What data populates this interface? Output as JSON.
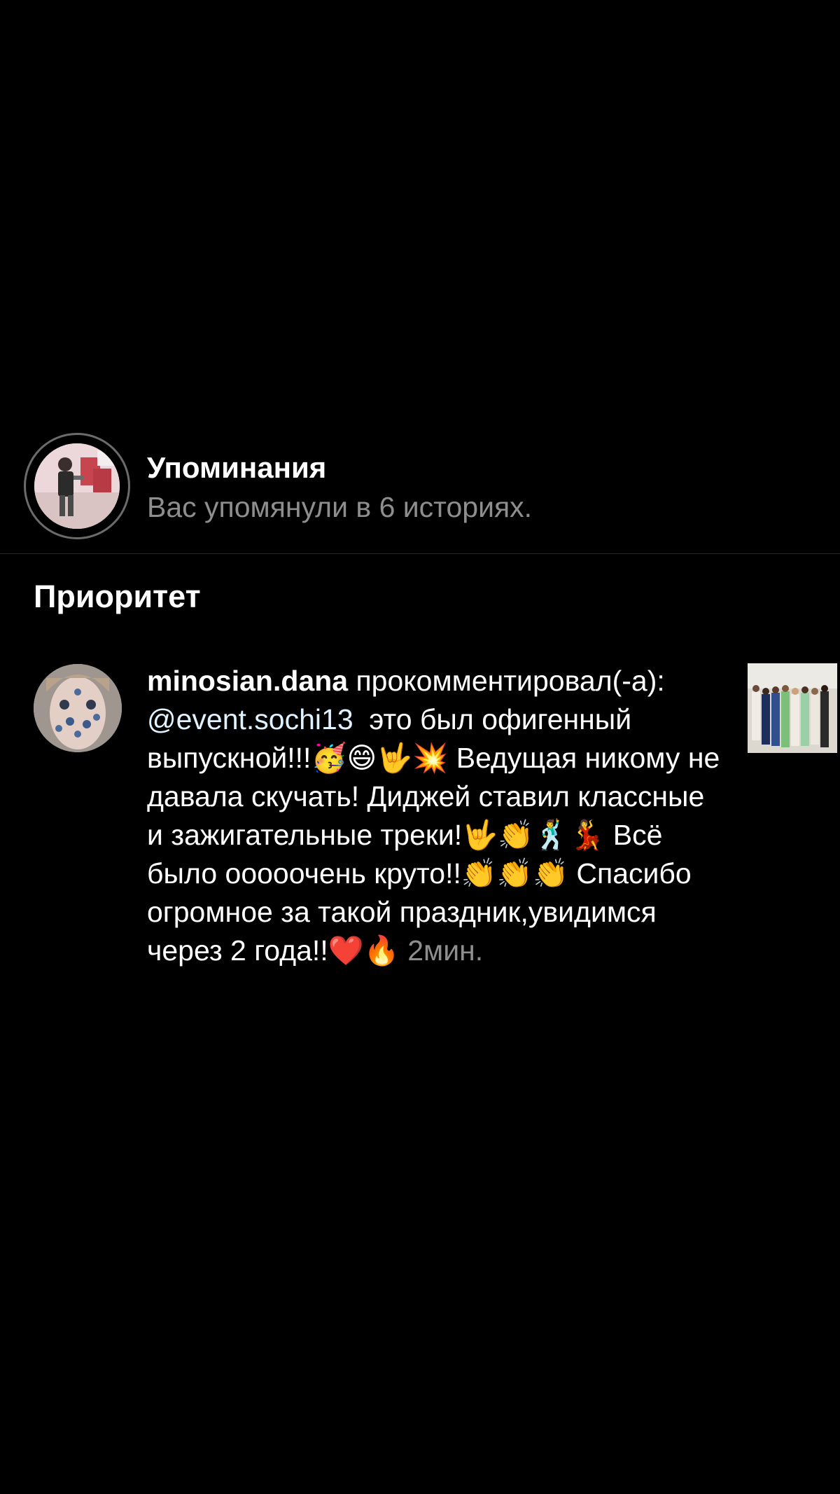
{
  "mentions": {
    "title": "Упоминания",
    "subtitle": "Вас упомянули в 6 историях."
  },
  "section": {
    "title": "Приоритет"
  },
  "comment": {
    "username": "minosian.dana",
    "action": " прокомментировал(-а): ",
    "mention": "@event.sochi13",
    "text": "  это был офигенный выпускной!!!🥳😄🤟💥 Ведущая никому не давала скучать! Диджей ставил классные и зажигательные треки!🤟👏🕺💃 Всё было ооооочень круто!!👏👏👏 Спасибо огромное за такой праздник,увидимся через 2 года!!❤️🔥 ",
    "time": "2мин."
  },
  "icons": {
    "avatar": "mentions-story-avatar",
    "commenter": "commenter-avatar",
    "thumbnail": "post-thumbnail"
  }
}
